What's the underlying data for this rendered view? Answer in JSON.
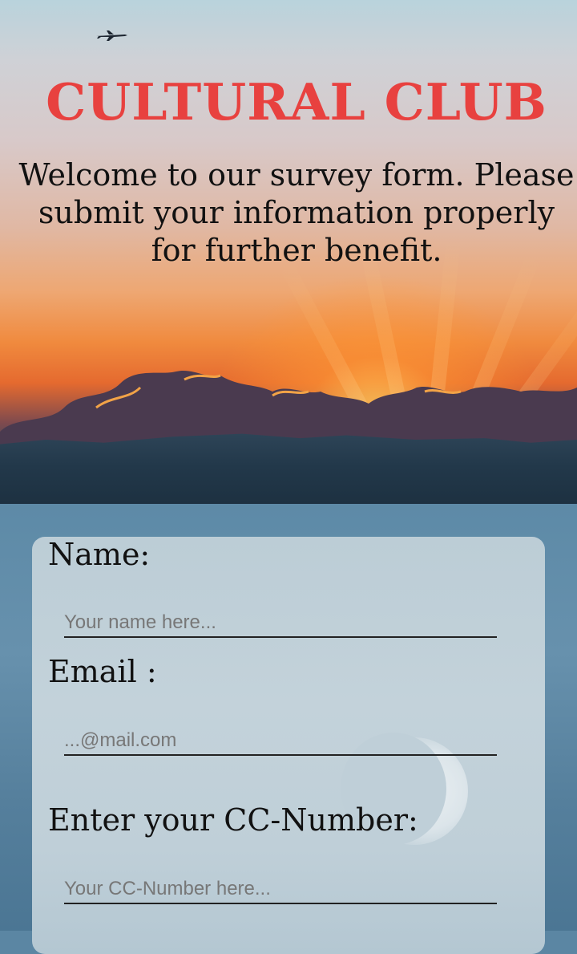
{
  "header": {
    "title": "CULTURAL CLUB",
    "subtitle": "Welcome to our survey form. Please submit your information properly for further benefit."
  },
  "form": {
    "name_label": "Name:",
    "name_placeholder": "Your name here...",
    "email_label": "Email :",
    "email_placeholder": "...@mail.com",
    "cc_label": "Enter your CC-Number:",
    "cc_placeholder": "Your CC-Number here..."
  },
  "colors": {
    "title": "#e8413f",
    "text": "#111111"
  },
  "icons": {
    "plane": "airplane-icon"
  }
}
